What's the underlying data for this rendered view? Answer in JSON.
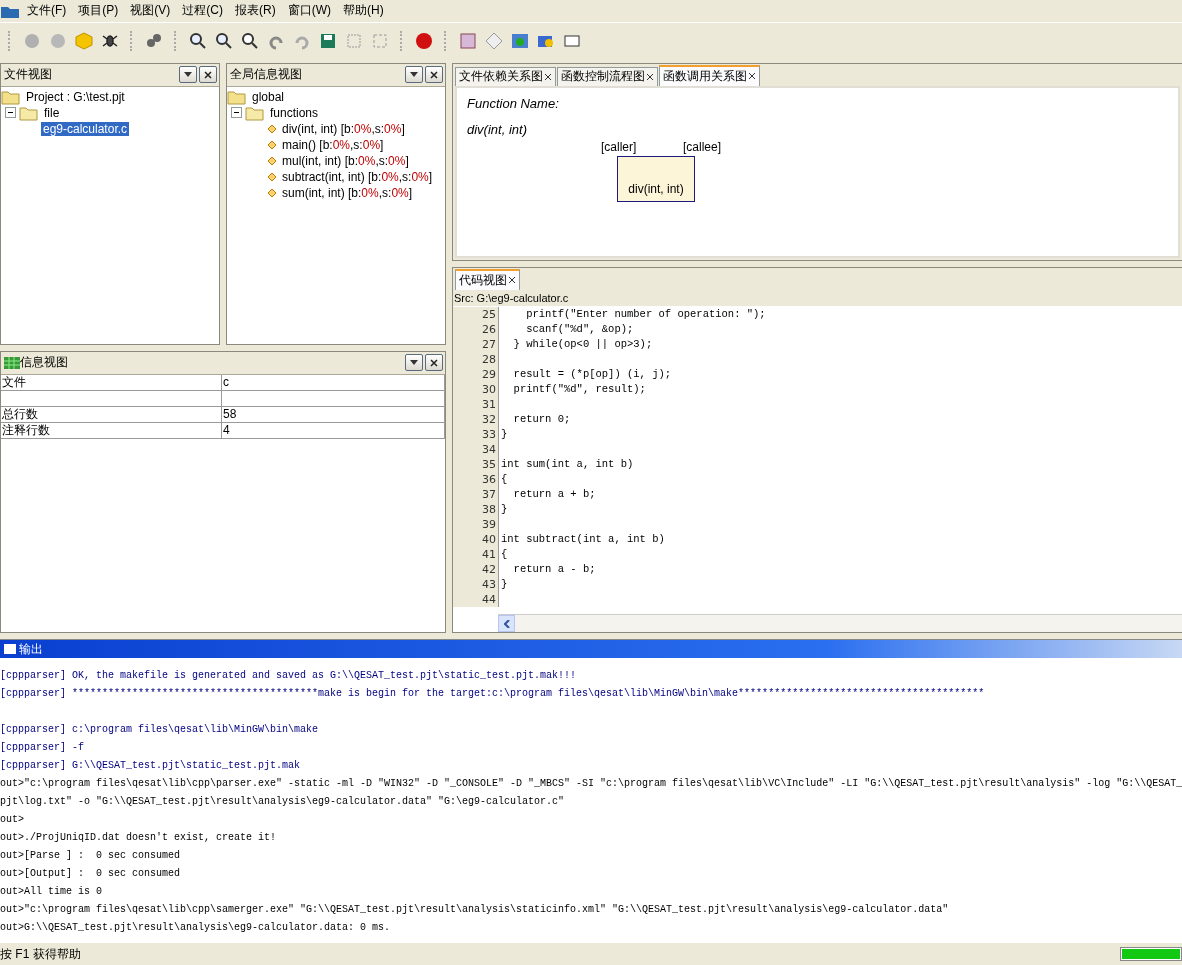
{
  "menu": [
    "文件(F)",
    "项目(P)",
    "视图(V)",
    "过程(C)",
    "报表(R)",
    "窗口(W)",
    "帮助(H)"
  ],
  "file_view": {
    "title": "文件视图",
    "tree": [
      {
        "label": "Project : G:\\test.pjt",
        "selected": false
      },
      {
        "label": "file",
        "expanded": true,
        "selected": false,
        "children": [
          {
            "label": "eg9-calculator.c",
            "selected": true
          }
        ]
      }
    ]
  },
  "global_view": {
    "title": "全局信息视图",
    "root": "global",
    "group": {
      "label": "functions",
      "expanded": true
    },
    "functions": [
      {
        "segments": [
          {
            "text": "div(int, int) [b:",
            "highlight": false
          },
          {
            "text": "0%",
            "highlight": true
          },
          {
            "text": ",s:",
            "highlight": false
          },
          {
            "text": "0%",
            "highlight": true
          },
          {
            "text": "]",
            "highlight": false
          }
        ]
      },
      {
        "segments": [
          {
            "text": "main() [b:",
            "highlight": false
          },
          {
            "text": "0%",
            "highlight": true
          },
          {
            "text": ",s:",
            "highlight": false
          },
          {
            "text": "0%",
            "highlight": true
          },
          {
            "text": "]",
            "highlight": false
          }
        ]
      },
      {
        "segments": [
          {
            "text": "mul(int, int) [b:",
            "highlight": false
          },
          {
            "text": "0%",
            "highlight": true
          },
          {
            "text": ",s:",
            "highlight": false
          },
          {
            "text": "0%",
            "highlight": true
          },
          {
            "text": "]",
            "highlight": false
          }
        ]
      },
      {
        "segments": [
          {
            "text": "subtract(int, int) [b:",
            "highlight": false
          },
          {
            "text": "0%",
            "highlight": true
          },
          {
            "text": ",s:",
            "highlight": false
          },
          {
            "text": "0%",
            "highlight": true
          },
          {
            "text": "]",
            "highlight": false
          }
        ]
      },
      {
        "segments": [
          {
            "text": "sum(int, int) [b:",
            "highlight": false
          },
          {
            "text": "0%",
            "highlight": true
          },
          {
            "text": ",s:",
            "highlight": false
          },
          {
            "text": "0%",
            "highlight": true
          },
          {
            "text": "]",
            "highlight": false
          }
        ]
      }
    ]
  },
  "info_view": {
    "title": "信息视图",
    "rows": [
      {
        "kind": "pair",
        "key": "文件",
        "value": "c"
      },
      {
        "kind": "blank"
      },
      {
        "kind": "pair",
        "key": "总行数",
        "value": "58"
      },
      {
        "kind": "pair",
        "key": "注释行数",
        "value": "4"
      }
    ]
  },
  "diagram_tabs": [
    {
      "label": "文件依赖关系图",
      "selected": false
    },
    {
      "label": "函数控制流程图",
      "selected": false
    },
    {
      "label": "函数调用关系图",
      "selected": true
    }
  ],
  "diagram": {
    "heading": "Function Name:",
    "function": "div(int,  int)",
    "caller_label": "[caller]",
    "callee_label": "[callee]",
    "node": "div(int, int)"
  },
  "code_tabs": [
    {
      "label": "代码视图",
      "selected": true
    }
  ],
  "code": {
    "source": "Src: G:\\eg9-calculator.c",
    "lines": [
      {
        "n": "25",
        "text": "    printf(\"Enter number of operation: \");"
      },
      {
        "n": "26",
        "text": "    scanf(\"%d\", &op);"
      },
      {
        "n": "27",
        "text": "  } while(op<0 || op>3);"
      },
      {
        "n": "28"
      },
      {
        "n": "29",
        "text": "  result = (*p[op]) (i, j);"
      },
      {
        "n": "30",
        "text": "  printf(\"%d\", result);"
      },
      {
        "n": "31"
      },
      {
        "n": "32",
        "text": "  return 0;"
      },
      {
        "n": "33",
        "text": "}"
      },
      {
        "n": "34"
      },
      {
        "n": "35",
        "text": "int sum(int a, int b)"
      },
      {
        "n": "36",
        "text": "{"
      },
      {
        "n": "37",
        "text": "  return a + b;"
      },
      {
        "n": "38",
        "text": "}"
      },
      {
        "n": "39"
      },
      {
        "n": "40",
        "text": "int subtract(int a, int b)"
      },
      {
        "n": "41",
        "text": "{"
      },
      {
        "n": "42",
        "text": "  return a - b;"
      },
      {
        "n": "43",
        "text": "}"
      },
      {
        "n": "44"
      }
    ]
  },
  "output": {
    "title": "输出",
    "lines": [
      {
        "kind": "text",
        "text": "[cppparser] OK, the makefile is generated and saved as G:\\\\QESAT_test.pjt\\static_test.pjt.mak!!!"
      },
      {
        "kind": "text",
        "text": "[cppparser] *****************************************make is begin for the target:c:\\program files\\qesat\\lib\\MinGW\\bin\\make*****************************************"
      },
      {
        "kind": "blank"
      },
      {
        "kind": "text",
        "text": "[cppparser] c:\\program files\\qesat\\lib\\MinGW\\bin\\make"
      },
      {
        "kind": "text",
        "text": "[cppparser] -f"
      },
      {
        "kind": "text",
        "text": "[cppparser] G:\\\\QESAT_test.pjt\\static_test.pjt.mak"
      },
      {
        "kind": "text",
        "text": "out>\"c:\\program files\\qesat\\lib\\cpp\\parser.exe\" -static -ml -D \"WIN32\" -D \"_CONSOLE\" -D \"_MBCS\" -SI \"c:\\program files\\qesat\\lib\\VC\\Include\" -LI \"G:\\\\QESAT_test.pjt\\result\\analysis\" -log \"G:\\\\QESAT_"
      },
      {
        "kind": "text",
        "text": "pjt\\log.txt\" -o \"G:\\\\QESAT_test.pjt\\result\\analysis\\eg9-calculator.data\" \"G:\\eg9-calculator.c\""
      },
      {
        "kind": "text",
        "text": "out>"
      },
      {
        "kind": "text",
        "text": "out>./ProjUniqID.dat doesn't exist, create it!"
      },
      {
        "kind": "text",
        "text": "out>[Parse ] :  0 sec consumed"
      },
      {
        "kind": "text",
        "text": "out>[Output] :  0 sec consumed"
      },
      {
        "kind": "text",
        "text": "out>All time is 0"
      },
      {
        "kind": "text",
        "text": "out>\"c:\\program files\\qesat\\lib\\cpp\\samerger.exe\" \"G:\\\\QESAT_test.pjt\\result\\analysis\\staticinfo.xml\" \"G:\\\\QESAT_test.pjt\\result\\analysis\\eg9-calculator.data\""
      },
      {
        "kind": "text",
        "text": "out>G:\\\\QESAT_test.pjt\\result\\analysis\\eg9-calculator.data: 0 ms."
      }
    ]
  },
  "status_bar": {
    "text": "按 F1 获得帮助",
    "progress": {
      "level": 1
    }
  }
}
